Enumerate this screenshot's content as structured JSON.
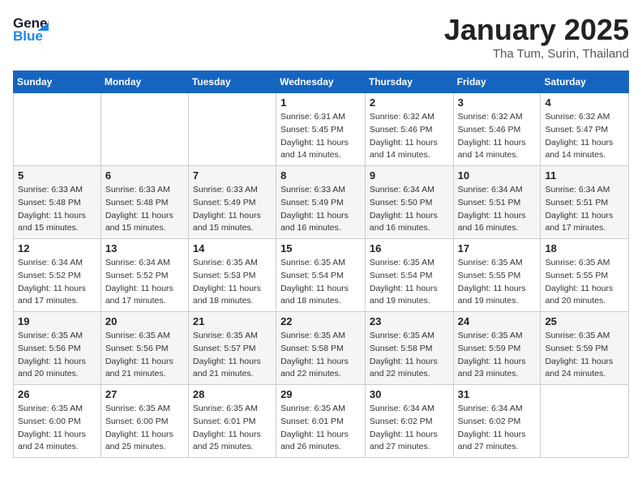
{
  "header": {
    "logo_general": "General",
    "logo_blue": "Blue",
    "month_title": "January 2025",
    "location": "Tha Tum, Surin, Thailand"
  },
  "weekdays": [
    "Sunday",
    "Monday",
    "Tuesday",
    "Wednesday",
    "Thursday",
    "Friday",
    "Saturday"
  ],
  "weeks": [
    [
      {
        "day": "",
        "info": ""
      },
      {
        "day": "",
        "info": ""
      },
      {
        "day": "",
        "info": ""
      },
      {
        "day": "1",
        "info": "Sunrise: 6:31 AM\nSunset: 5:45 PM\nDaylight: 11 hours and 14 minutes."
      },
      {
        "day": "2",
        "info": "Sunrise: 6:32 AM\nSunset: 5:46 PM\nDaylight: 11 hours and 14 minutes."
      },
      {
        "day": "3",
        "info": "Sunrise: 6:32 AM\nSunset: 5:46 PM\nDaylight: 11 hours and 14 minutes."
      },
      {
        "day": "4",
        "info": "Sunrise: 6:32 AM\nSunset: 5:47 PM\nDaylight: 11 hours and 14 minutes."
      }
    ],
    [
      {
        "day": "5",
        "info": "Sunrise: 6:33 AM\nSunset: 5:48 PM\nDaylight: 11 hours and 15 minutes."
      },
      {
        "day": "6",
        "info": "Sunrise: 6:33 AM\nSunset: 5:48 PM\nDaylight: 11 hours and 15 minutes."
      },
      {
        "day": "7",
        "info": "Sunrise: 6:33 AM\nSunset: 5:49 PM\nDaylight: 11 hours and 15 minutes."
      },
      {
        "day": "8",
        "info": "Sunrise: 6:33 AM\nSunset: 5:49 PM\nDaylight: 11 hours and 16 minutes."
      },
      {
        "day": "9",
        "info": "Sunrise: 6:34 AM\nSunset: 5:50 PM\nDaylight: 11 hours and 16 minutes."
      },
      {
        "day": "10",
        "info": "Sunrise: 6:34 AM\nSunset: 5:51 PM\nDaylight: 11 hours and 16 minutes."
      },
      {
        "day": "11",
        "info": "Sunrise: 6:34 AM\nSunset: 5:51 PM\nDaylight: 11 hours and 17 minutes."
      }
    ],
    [
      {
        "day": "12",
        "info": "Sunrise: 6:34 AM\nSunset: 5:52 PM\nDaylight: 11 hours and 17 minutes."
      },
      {
        "day": "13",
        "info": "Sunrise: 6:34 AM\nSunset: 5:52 PM\nDaylight: 11 hours and 17 minutes."
      },
      {
        "day": "14",
        "info": "Sunrise: 6:35 AM\nSunset: 5:53 PM\nDaylight: 11 hours and 18 minutes."
      },
      {
        "day": "15",
        "info": "Sunrise: 6:35 AM\nSunset: 5:54 PM\nDaylight: 11 hours and 18 minutes."
      },
      {
        "day": "16",
        "info": "Sunrise: 6:35 AM\nSunset: 5:54 PM\nDaylight: 11 hours and 19 minutes."
      },
      {
        "day": "17",
        "info": "Sunrise: 6:35 AM\nSunset: 5:55 PM\nDaylight: 11 hours and 19 minutes."
      },
      {
        "day": "18",
        "info": "Sunrise: 6:35 AM\nSunset: 5:55 PM\nDaylight: 11 hours and 20 minutes."
      }
    ],
    [
      {
        "day": "19",
        "info": "Sunrise: 6:35 AM\nSunset: 5:56 PM\nDaylight: 11 hours and 20 minutes."
      },
      {
        "day": "20",
        "info": "Sunrise: 6:35 AM\nSunset: 5:56 PM\nDaylight: 11 hours and 21 minutes."
      },
      {
        "day": "21",
        "info": "Sunrise: 6:35 AM\nSunset: 5:57 PM\nDaylight: 11 hours and 21 minutes."
      },
      {
        "day": "22",
        "info": "Sunrise: 6:35 AM\nSunset: 5:58 PM\nDaylight: 11 hours and 22 minutes."
      },
      {
        "day": "23",
        "info": "Sunrise: 6:35 AM\nSunset: 5:58 PM\nDaylight: 11 hours and 22 minutes."
      },
      {
        "day": "24",
        "info": "Sunrise: 6:35 AM\nSunset: 5:59 PM\nDaylight: 11 hours and 23 minutes."
      },
      {
        "day": "25",
        "info": "Sunrise: 6:35 AM\nSunset: 5:59 PM\nDaylight: 11 hours and 24 minutes."
      }
    ],
    [
      {
        "day": "26",
        "info": "Sunrise: 6:35 AM\nSunset: 6:00 PM\nDaylight: 11 hours and 24 minutes."
      },
      {
        "day": "27",
        "info": "Sunrise: 6:35 AM\nSunset: 6:00 PM\nDaylight: 11 hours and 25 minutes."
      },
      {
        "day": "28",
        "info": "Sunrise: 6:35 AM\nSunset: 6:01 PM\nDaylight: 11 hours and 25 minutes."
      },
      {
        "day": "29",
        "info": "Sunrise: 6:35 AM\nSunset: 6:01 PM\nDaylight: 11 hours and 26 minutes."
      },
      {
        "day": "30",
        "info": "Sunrise: 6:34 AM\nSunset: 6:02 PM\nDaylight: 11 hours and 27 minutes."
      },
      {
        "day": "31",
        "info": "Sunrise: 6:34 AM\nSunset: 6:02 PM\nDaylight: 11 hours and 27 minutes."
      },
      {
        "day": "",
        "info": ""
      }
    ]
  ]
}
